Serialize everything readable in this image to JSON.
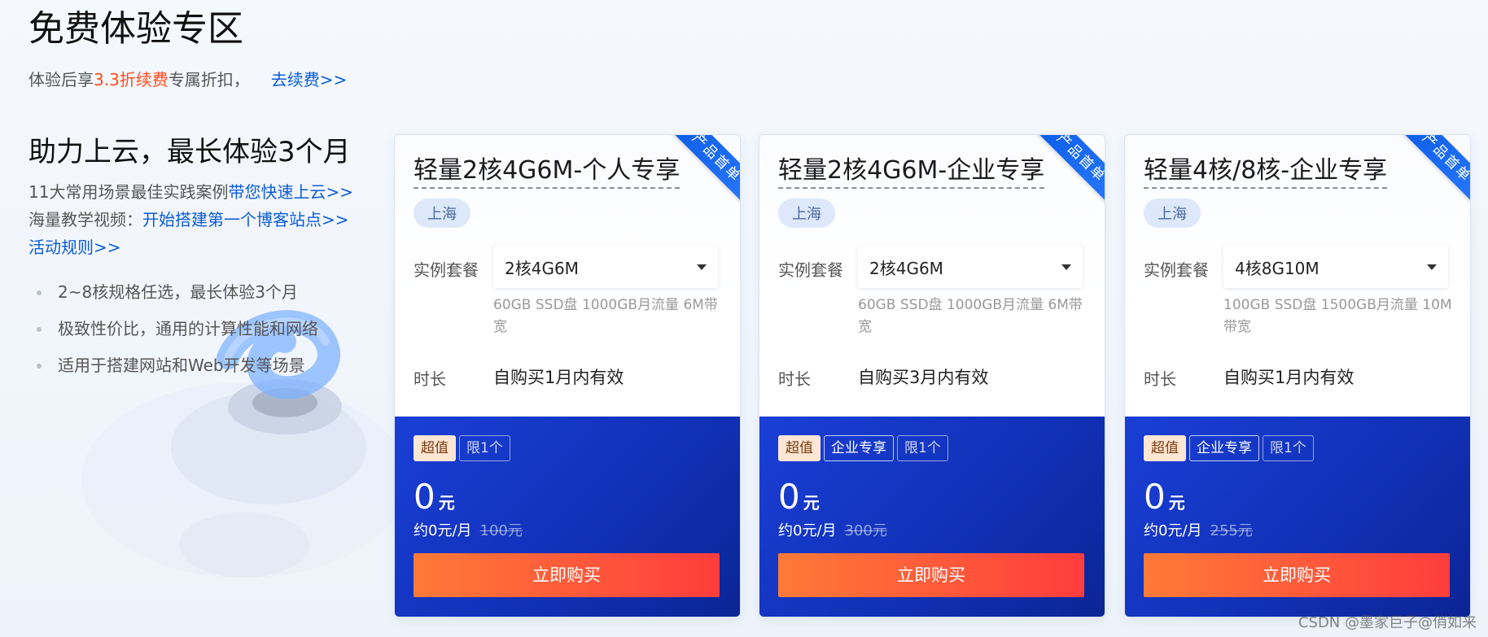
{
  "header": {
    "title": "免费体验专区",
    "subtitle_prefix": "体验后享",
    "subtitle_highlight": "3.3折续费",
    "subtitle_suffix": "专属折扣，",
    "renew_link": "去续费>>"
  },
  "left": {
    "heading": "助力上云，最长体验3个月",
    "line1_prefix": "11大常用场景最佳实践案例",
    "line1_link": "带您快速上云>>",
    "line2_prefix": "海量教学视频：",
    "line2_link": "开始搭建第一个博客站点>>",
    "rules_link": "活动规则>>",
    "bullets": [
      "2~8核规格任选，最长体验3个月",
      "极致性价比，通用的计算性能和网络",
      "适用于搭建网站和Web开发等场景"
    ]
  },
  "labels": {
    "instance": "实例套餐",
    "duration": "时长",
    "ribbon": "产品首单",
    "buy": "立即购买",
    "unit": "元"
  },
  "cards": [
    {
      "title": "轻量2核4G6M-个人专享",
      "region": "上海",
      "instance": "2核4G6M",
      "spec": "60GB SSD盘 1000GB月流量 6M带宽",
      "duration": "自购买1月内有效",
      "tags": [
        "超值",
        "限1个"
      ],
      "price": "0",
      "monthly": "约0元/月",
      "original": "100元"
    },
    {
      "title": "轻量2核4G6M-企业专享",
      "region": "上海",
      "instance": "2核4G6M",
      "spec": "60GB SSD盘 1000GB月流量 6M带宽",
      "duration": "自购买3月内有效",
      "tags": [
        "超值",
        "企业专享",
        "限1个"
      ],
      "price": "0",
      "monthly": "约0元/月",
      "original": "300元"
    },
    {
      "title": "轻量4核/8核-企业专享",
      "region": "上海",
      "instance": "4核8G10M",
      "spec": "100GB SSD盘 1500GB月流量 10M带宽",
      "duration": "自购买1月内有效",
      "tags": [
        "超值",
        "企业专享",
        "限1个"
      ],
      "price": "0",
      "monthly": "约0元/月",
      "original": "255元"
    }
  ],
  "watermark": "CSDN @墨家巨子@俏如来",
  "colors": {
    "accent_orange": "#ff4a1c",
    "link_blue": "#0a5bd8",
    "card_bottom_blue": "#1131b8",
    "buy_gradient_start": "#ff7a37",
    "buy_gradient_end": "#ff3d3d"
  }
}
